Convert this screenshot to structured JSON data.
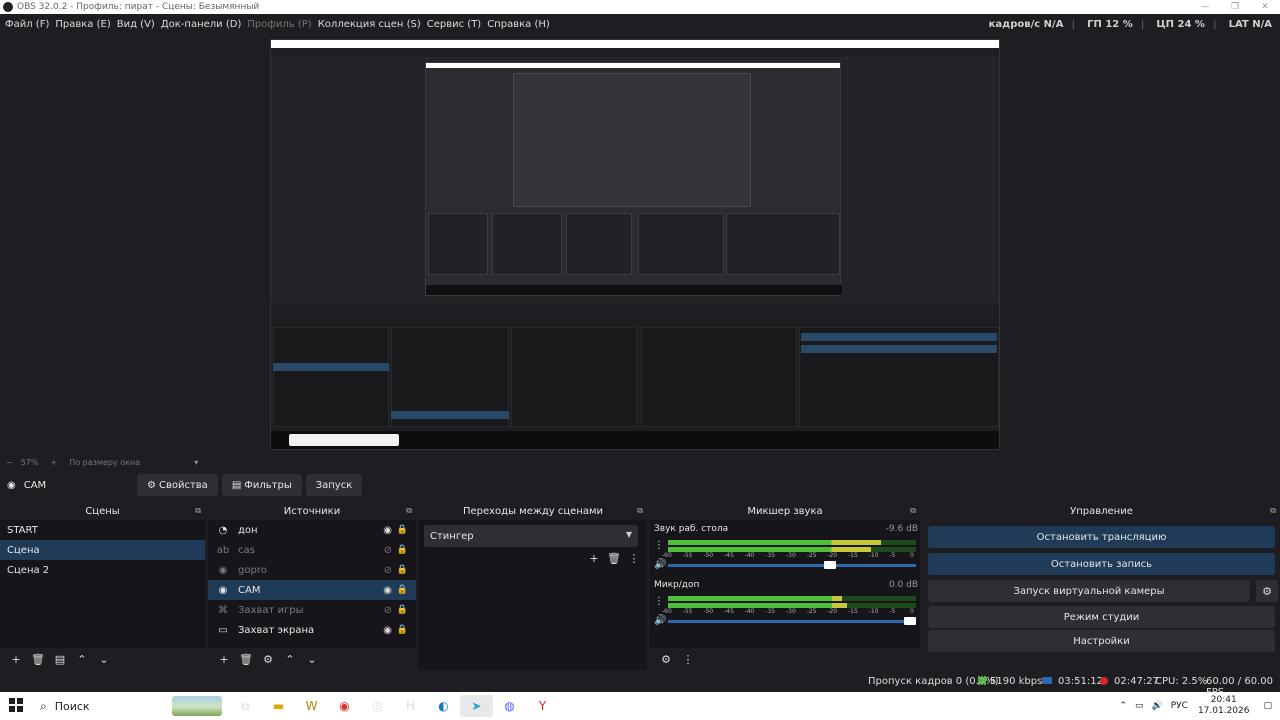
{
  "window": {
    "title": "OBS 32.0.2 - Профиль: пират - Сцены: Безымянный"
  },
  "menu": [
    {
      "label": "Файл (F)",
      "enabled": true
    },
    {
      "label": "Правка (E)",
      "enabled": true
    },
    {
      "label": "Вид (V)",
      "enabled": true
    },
    {
      "label": "Док-панели (D)",
      "enabled": true
    },
    {
      "label": "Профиль (P)",
      "enabled": false
    },
    {
      "label": "Коллекция сцен (S)",
      "enabled": true
    },
    {
      "label": "Сервис (T)",
      "enabled": true
    },
    {
      "label": "Справка (H)",
      "enabled": true
    }
  ],
  "stats": {
    "fps": "кадров/с N/A",
    "gpu": "ГП 12 %",
    "cpu": "ЦП 24 %",
    "lat": "LAT N/A"
  },
  "zoom": {
    "minus": "−",
    "value": "57%",
    "plus": "+",
    "mode": "По размеру окна",
    "chevron": "▾"
  },
  "source_toolbar": {
    "current_source": "CAM",
    "properties": "Свойства",
    "filters": "Фильтры",
    "launch": "Запуск"
  },
  "docks": {
    "scenes": {
      "title": "Сцены",
      "items": [
        {
          "name": "START",
          "selected": false
        },
        {
          "name": "Сцена",
          "selected": true
        },
        {
          "name": "Сцена 2",
          "selected": false
        }
      ]
    },
    "sources": {
      "title": "Источники",
      "items": [
        {
          "name": "дон",
          "icon": "media-icon",
          "visible": true,
          "selected": false
        },
        {
          "name": "cas",
          "icon": "text-icon",
          "visible": false,
          "selected": false
        },
        {
          "name": "gopro",
          "icon": "camera-icon",
          "visible": false,
          "selected": false
        },
        {
          "name": "CAM",
          "icon": "camera-icon",
          "visible": true,
          "selected": true
        },
        {
          "name": "Захват игры",
          "icon": "gamepad-icon",
          "visible": false,
          "selected": false
        },
        {
          "name": "Захват экрана",
          "icon": "monitor-icon",
          "visible": true,
          "selected": false
        }
      ]
    },
    "transitions": {
      "title": "Переходы между сценами",
      "selected": "Стингер"
    },
    "mixer": {
      "title": "Микшер звука",
      "ticks": [
        "-60",
        "-55",
        "-50",
        "-45",
        "-40",
        "-35",
        "-30",
        "-25",
        "-20",
        "-15",
        "-10",
        "-5",
        "0"
      ],
      "channels": [
        {
          "name": "Звук раб. стола",
          "db": "-9.6 dB",
          "level_top": 0.86,
          "level_bottom": 0.82,
          "volume": 0.66
        },
        {
          "name": "Микр/доп",
          "db": "0.0 dB",
          "level_top": 0.7,
          "level_bottom": 0.72,
          "volume": 1.0
        }
      ]
    },
    "controls": {
      "title": "Управление",
      "stop_stream": "Остановить трансляцию",
      "stop_record": "Остановить запись",
      "virtual_cam": "Запуск виртуальной камеры",
      "studio_mode": "Режим студии",
      "settings": "Настройки"
    }
  },
  "status": {
    "dropped": "Пропуск кадров 0 (0.0%)",
    "bitrate": "5190 kbps",
    "stream_time": "03:51:12",
    "rec_time": "02:47:27",
    "cpu": "CPU: 2.5%",
    "fps": "60.00 / 60.00 FPS"
  },
  "taskbar": {
    "search": "Поиск",
    "lang": "РУС",
    "time": "20:41",
    "date": "17.01.2026"
  },
  "colors": {
    "accent": "#1f3b57",
    "meter_green": "#4fbf3a",
    "meter_yellow": "#c8c83a",
    "meter_red": "#c83a3a",
    "rec_red": "#d62a2a"
  }
}
